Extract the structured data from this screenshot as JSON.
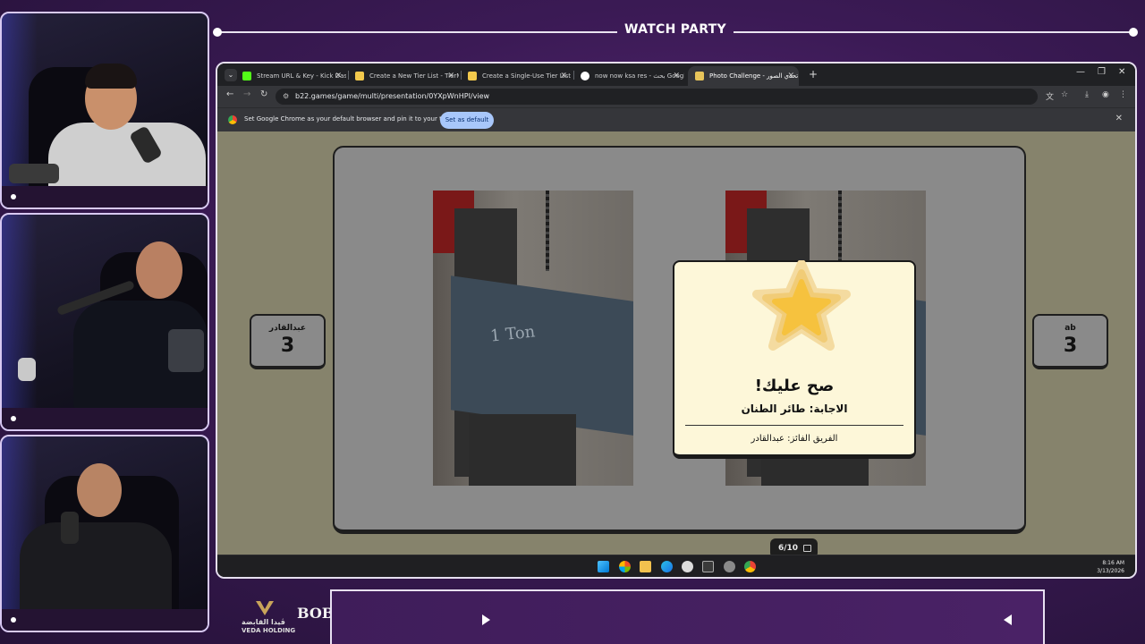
{
  "overlay": {
    "title": "WATCH PARTY",
    "sponsor_veda": "VEDA HOLDING",
    "sponsor_veda_ar": "ڤيدا القابضة",
    "sponsor_bob": "BOBS"
  },
  "browser": {
    "tabs": [
      {
        "label": "Stream URL & Key - Kick Dashb",
        "favicon_color": "#53fc18",
        "active": false
      },
      {
        "label": "Create a New Tier List - TierMa",
        "favicon_color": "#f2c94c",
        "active": false
      },
      {
        "label": "Create a Single-Use Tier List (F",
        "favicon_color": "#f2c94c",
        "active": false
      },
      {
        "label": "now now ksa res - بحث Google",
        "favicon_color": "#ffffff",
        "active": false
      },
      {
        "label": "Photo Challenge - تحدي الصور",
        "favicon_color": "#e7c45a",
        "active": true
      }
    ],
    "url": "b22.games/game/multi/presentation/0YXpWnHPI/view",
    "infobar_message": "Set Google Chrome as your default browser and pin it to your taskbar",
    "infobar_button": "Set as default"
  },
  "game": {
    "team_left": {
      "name": "عبدالقادر",
      "score": "3"
    },
    "team_right": {
      "name": "ab",
      "score": "3"
    },
    "photo_label": "1 Ton",
    "modal": {
      "headline": "صح عليك!",
      "answer": "الاجابة: طائر الطنان",
      "winner": "الفريق الفائز: عبدالقادر"
    },
    "progress": "6/10"
  },
  "taskbar": {
    "time": "8:16 AM",
    "date": "3/13/2026"
  },
  "colors": {
    "accent_purple": "#3b1a55",
    "modal_bg": "#fdf7d9",
    "star": "#f6c23e",
    "viewport_bg": "#86836c"
  }
}
